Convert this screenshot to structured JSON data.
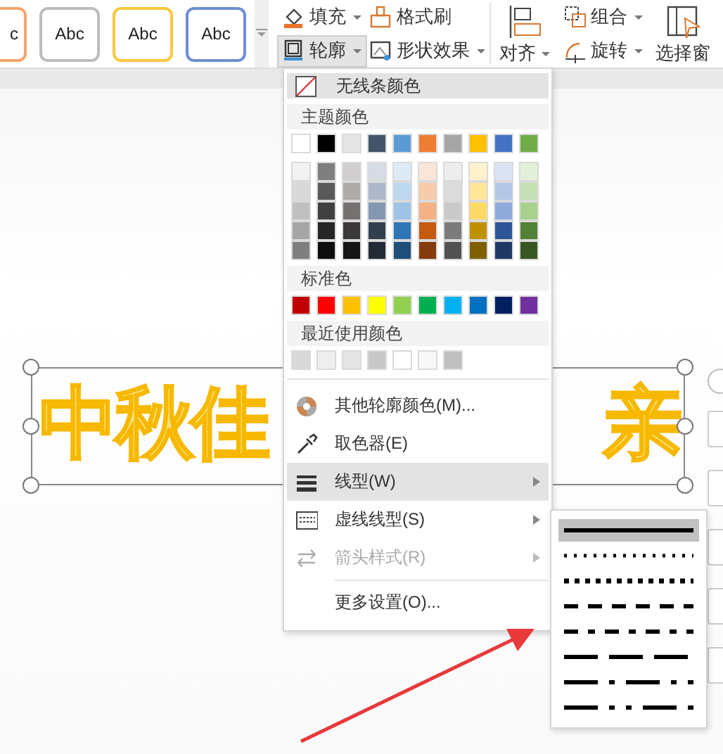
{
  "ribbon": {
    "style_presets": [
      {
        "label": "c",
        "color": "#f4a46a"
      },
      {
        "label": "Abc",
        "color": "#bdbdbd"
      },
      {
        "label": "Abc",
        "color": "#fcc83c"
      },
      {
        "label": "Abc",
        "color": "#6c8fd6"
      }
    ],
    "tools": [
      {
        "label": "填充",
        "kind": "fill",
        "dropdown": true,
        "pressed": false
      },
      {
        "label": "格式刷",
        "kind": "brush",
        "dropdown": false,
        "pressed": false
      },
      {
        "label": "轮廓",
        "kind": "outline",
        "dropdown": true,
        "pressed": true
      },
      {
        "label": "形状效果",
        "kind": "effects",
        "dropdown": true,
        "pressed": false
      }
    ],
    "arrange": [
      {
        "label": "对齐",
        "kind": "align",
        "dropdown": true
      },
      {
        "label": "组合",
        "kind": "group",
        "dropdown": true
      },
      {
        "label": "旋转",
        "kind": "rotate",
        "dropdown": true
      },
      {
        "label": "选择窗",
        "kind": "pane",
        "dropdown": false
      }
    ]
  },
  "slide": {
    "title_parts": [
      "中秋佳",
      "亲"
    ]
  },
  "outline_menu": {
    "no_line": {
      "label": "无线条颜色",
      "highlighted": true
    },
    "theme_heading": "主题颜色",
    "theme_colors": [
      {
        "color": "#ffffff"
      },
      {
        "color": "#000000"
      },
      {
        "color": "#e7e6e6"
      },
      {
        "color": "#44546a"
      },
      {
        "color": "#5b9bd5"
      },
      {
        "color": "#ed7d31"
      },
      {
        "color": "#a5a5a5"
      },
      {
        "color": "#ffc000"
      },
      {
        "color": "#4472c4"
      },
      {
        "color": "#70ad47"
      }
    ],
    "shades": [
      [
        {
          "color": "#f2f2f2"
        },
        {
          "color": "#7f7f7f"
        },
        {
          "color": "#d0cece"
        },
        {
          "color": "#d6dce5"
        },
        {
          "color": "#deebf7"
        },
        {
          "color": "#fbe5d6"
        },
        {
          "color": "#ededed"
        },
        {
          "color": "#fff2cc"
        },
        {
          "color": "#dae3f3"
        },
        {
          "color": "#e2f0d9"
        }
      ],
      [
        {
          "color": "#d9d9d9"
        },
        {
          "color": "#595959"
        },
        {
          "color": "#aeaaaa"
        },
        {
          "color": "#adb9ca"
        },
        {
          "color": "#bdd7ee"
        },
        {
          "color": "#f8cbad"
        },
        {
          "color": "#dbdbdb"
        },
        {
          "color": "#ffe699"
        },
        {
          "color": "#b4c7e7"
        },
        {
          "color": "#c5e0b4"
        }
      ],
      [
        {
          "color": "#bfbfbf"
        },
        {
          "color": "#404040"
        },
        {
          "color": "#757171"
        },
        {
          "color": "#8497b0"
        },
        {
          "color": "#9dc3e6"
        },
        {
          "color": "#f4b183"
        },
        {
          "color": "#c9c9c9"
        },
        {
          "color": "#ffd966"
        },
        {
          "color": "#8faadc"
        },
        {
          "color": "#a9d18e"
        }
      ],
      [
        {
          "color": "#a6a6a6"
        },
        {
          "color": "#262626"
        },
        {
          "color": "#3a3838"
        },
        {
          "color": "#323f4f"
        },
        {
          "color": "#2e75b6"
        },
        {
          "color": "#c55a11"
        },
        {
          "color": "#7b7b7b"
        },
        {
          "color": "#bf9000"
        },
        {
          "color": "#2f5597"
        },
        {
          "color": "#538135"
        }
      ],
      [
        {
          "color": "#7f7f7f"
        },
        {
          "color": "#0d0d0d"
        },
        {
          "color": "#171616"
        },
        {
          "color": "#222a35"
        },
        {
          "color": "#1f4e79"
        },
        {
          "color": "#843c0c"
        },
        {
          "color": "#525252"
        },
        {
          "color": "#7f6000"
        },
        {
          "color": "#203864"
        },
        {
          "color": "#385723"
        }
      ]
    ],
    "standard_heading": "标准色",
    "standard_colors": [
      {
        "color": "#c00000"
      },
      {
        "color": "#ff0000"
      },
      {
        "color": "#ffc000"
      },
      {
        "color": "#ffff00"
      },
      {
        "color": "#92d050"
      },
      {
        "color": "#00b050"
      },
      {
        "color": "#00b0f0"
      },
      {
        "color": "#0070c0"
      },
      {
        "color": "#002060"
      },
      {
        "color": "#7030a0"
      }
    ],
    "recent_heading": "最近使用颜色",
    "recent_colors": [
      {
        "color": "#d9d9d9"
      },
      {
        "color": "#eeeeee"
      },
      {
        "color": "#e6e6e6"
      },
      {
        "color": "#c8c8c8"
      },
      {
        "color": "#ffffff"
      },
      {
        "color": "#f8f8f8"
      },
      {
        "color": "#bfbfbf"
      }
    ],
    "items": [
      {
        "label": "其他轮廓颜色(M)...",
        "kind": "palette",
        "highlighted": false,
        "disabled": false,
        "submenu": false
      },
      {
        "label": "取色器(E)",
        "kind": "picker",
        "highlighted": false,
        "disabled": false,
        "submenu": false
      },
      {
        "label": "线型(W)",
        "kind": "weight",
        "highlighted": true,
        "disabled": false,
        "submenu": true
      },
      {
        "label": "虚线线型(S)",
        "kind": "dash",
        "highlighted": false,
        "disabled": false,
        "submenu": true
      },
      {
        "label": "箭头样式(R)",
        "kind": "arrows",
        "highlighted": false,
        "disabled": true,
        "submenu": true
      },
      {
        "label": "更多设置(O)...",
        "kind": "settings",
        "highlighted": false,
        "disabled": false,
        "submenu": false
      }
    ]
  },
  "line_style_menu": {
    "styles": [
      {
        "kind": "solid",
        "selected": true
      },
      {
        "kind": "round_dot",
        "selected": false
      },
      {
        "kind": "square_dot",
        "selected": false
      },
      {
        "kind": "dash",
        "selected": false
      },
      {
        "kind": "dash_dot",
        "selected": false
      },
      {
        "kind": "long_dash",
        "selected": false
      },
      {
        "kind": "long_dash_dot",
        "selected": false
      },
      {
        "kind": "long_dash_dot_dot",
        "selected": false
      }
    ]
  }
}
